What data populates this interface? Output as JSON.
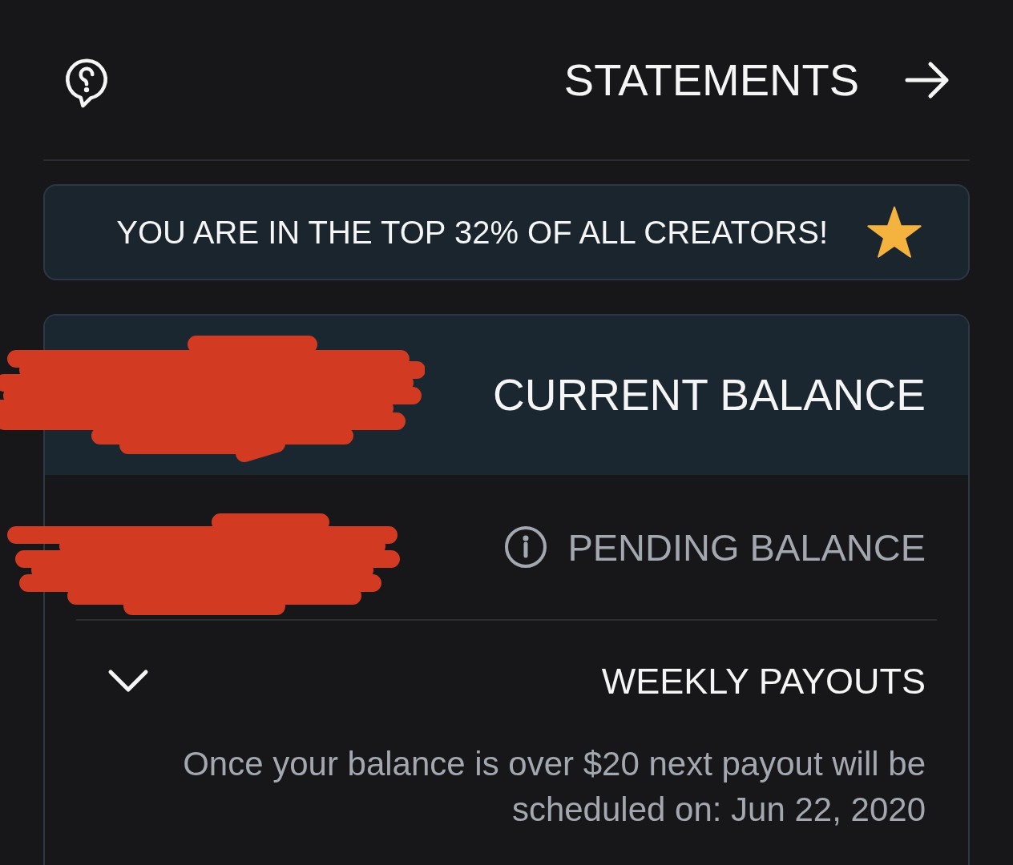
{
  "header": {
    "title": "STATEMENTS"
  },
  "banner": {
    "text": "YOU ARE IN THE TOP 32% OF ALL CREATORS!"
  },
  "balances": [
    {
      "kind": "current",
      "label": "CURRENT BALANCE"
    },
    {
      "kind": "pending",
      "label": "PENDING BALANCE"
    }
  ],
  "weekly_payouts": {
    "title": "WEEKLY PAYOUTS",
    "expanded": true,
    "description": "Once your balance is over $20 next payout will be scheduled on: Jun 22, 2020"
  }
}
